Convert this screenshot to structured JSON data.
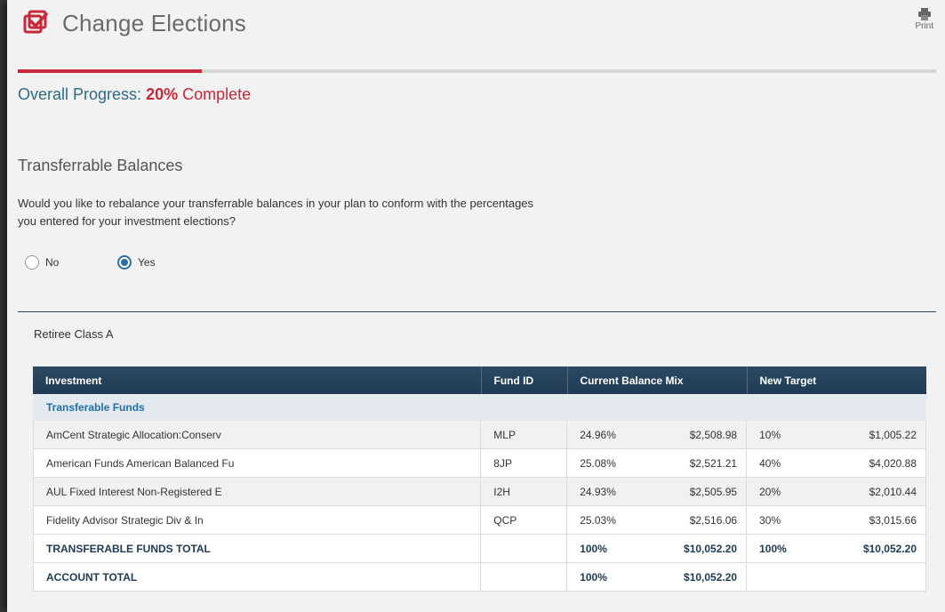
{
  "header": {
    "title": "Change Elections",
    "print_label": "Print"
  },
  "progress": {
    "prefix": "Overall Progress:",
    "percent_text": "20%",
    "suffix": "Complete",
    "fraction": 0.2
  },
  "section": {
    "title": "Transferrable Balances",
    "question_line1": "Would you like to rebalance your transferrable balances in your plan to conform with the percentages",
    "question_line2": "you entered for your investment elections?"
  },
  "radio": {
    "no_label": "No",
    "yes_label": "Yes",
    "selected": "Yes"
  },
  "account_class": "Retiree Class A",
  "table": {
    "headers": {
      "investment": "Investment",
      "fund_id": "Fund ID",
      "current": "Current Balance Mix",
      "new_target": "New Target"
    },
    "group_label": "Transferable Funds",
    "rows": [
      {
        "name": "AmCent Strategic Allocation:Conserv",
        "fund_id": "MLP",
        "cur_pct": "24.96%",
        "cur_amt": "$2,508.98",
        "new_pct": "10%",
        "new_amt": "$1,005.22"
      },
      {
        "name": "American Funds American Balanced Fu",
        "fund_id": "8JP",
        "cur_pct": "25.08%",
        "cur_amt": "$2,521.21",
        "new_pct": "40%",
        "new_amt": "$4,020.88"
      },
      {
        "name": "AUL Fixed Interest Non-Registered E",
        "fund_id": "I2H",
        "cur_pct": "24.93%",
        "cur_amt": "$2,505.95",
        "new_pct": "20%",
        "new_amt": "$2,010.44"
      },
      {
        "name": "Fidelity Advisor Strategic Div & In",
        "fund_id": "QCP",
        "cur_pct": "25.03%",
        "cur_amt": "$2,516.06",
        "new_pct": "30%",
        "new_amt": "$3,015.66"
      }
    ],
    "transferable_total": {
      "label": "TRANSFERABLE FUNDS TOTAL",
      "cur_pct": "100%",
      "cur_amt": "$10,052.20",
      "new_pct": "100%",
      "new_amt": "$10,052.20"
    },
    "account_total": {
      "label": "ACCOUNT TOTAL",
      "cur_pct": "100%",
      "cur_amt": "$10,052.20"
    }
  },
  "colors": {
    "accent": "#c8283c",
    "header_bg": "#1f3a54",
    "link_blue": "#1f6fa8"
  },
  "icons": {
    "title_icon": "checkbox-check-icon",
    "print_icon": "printer-icon"
  }
}
